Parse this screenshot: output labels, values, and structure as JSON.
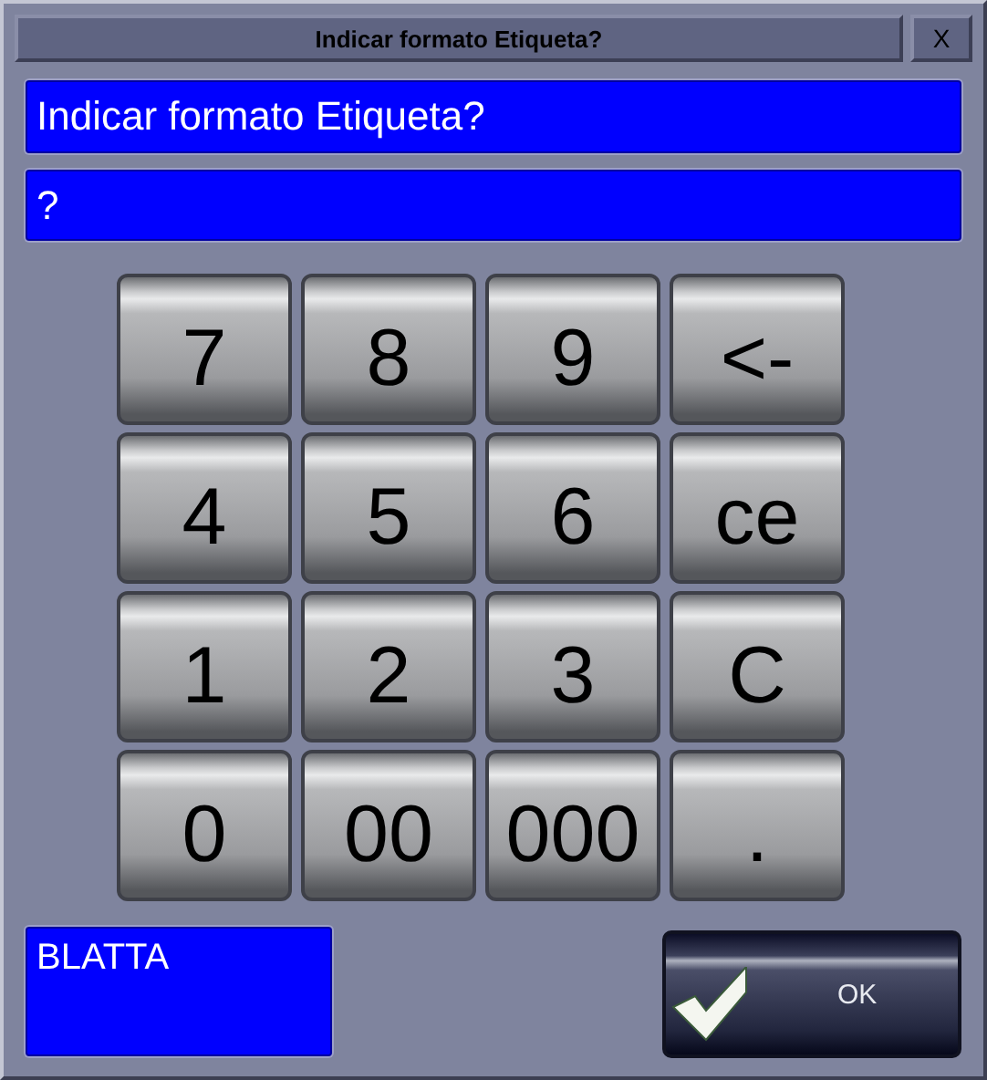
{
  "window": {
    "title": "Indicar formato Etiqueta?",
    "close": "X"
  },
  "prompt": "Indicar formato Etiqueta?",
  "input": {
    "value": "?"
  },
  "keypad": [
    [
      "7",
      "8",
      "9",
      "<-"
    ],
    [
      "4",
      "5",
      "6",
      "ce"
    ],
    [
      "1",
      "2",
      "3",
      "C"
    ],
    [
      "0",
      "00",
      "000",
      "."
    ]
  ],
  "info": "BLATTA",
  "ok_button": "OK"
}
